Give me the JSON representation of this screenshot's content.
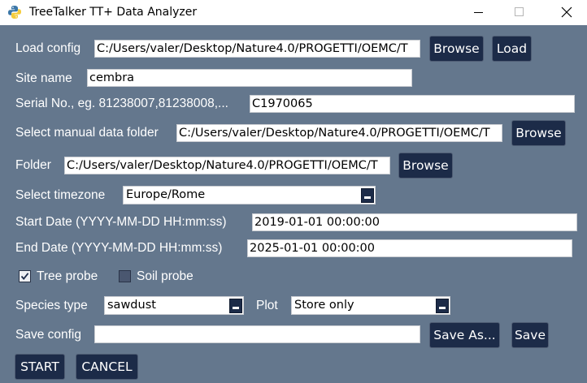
{
  "window": {
    "title": "TreeTalker TT+ Data Analyzer",
    "icon": "python-icon",
    "controls": [
      "minimize-icon",
      "maximize-icon",
      "close-icon"
    ]
  },
  "colors": {
    "background": "#64778d",
    "button": "#1c2b48",
    "text": "#ffffff",
    "field": "#ffffff"
  },
  "load_config": {
    "label": "Load config",
    "value": "C:/Users/valer/Desktop/Nature4.0/PROGETTI/OEMC/T",
    "browse_label": "Browse",
    "load_label": "Load"
  },
  "site_name": {
    "label": "Site name",
    "value": "cembra"
  },
  "serial_no": {
    "label": "Serial No., eg. 81238007,81238008,...",
    "value": "C1970065"
  },
  "manual_folder": {
    "label": "Select manual data folder",
    "value": "C:/Users/valer/Desktop/Nature4.0/PROGETTI/OEMC/T",
    "browse_label": "Browse"
  },
  "folder": {
    "label": "Folder",
    "value": "C:/Users/valer/Desktop/Nature4.0/PROGETTI/OEMC/T",
    "browse_label": "Browse"
  },
  "timezone": {
    "label": "Select timezone",
    "value": "Europe/Rome"
  },
  "start_date": {
    "label": "Start Date (YYYY-MM-DD HH:mm:ss)",
    "value": "2019-01-01 00:00:00"
  },
  "end_date": {
    "label": "End Date (YYYY-MM-DD HH:mm:ss)",
    "value": "2025-01-01 00:00:00"
  },
  "tree_probe": {
    "label": "Tree probe",
    "checked": true
  },
  "soil_probe": {
    "label": "Soil probe",
    "checked": false
  },
  "species": {
    "label": "Species type",
    "value": "sawdust"
  },
  "plot": {
    "label": "Plot",
    "value": "Store only"
  },
  "save_config": {
    "label": "Save config",
    "value": "",
    "save_as_label": "Save As...",
    "save_label": "Save"
  },
  "actions": {
    "start_label": "START",
    "cancel_label": "CANCEL"
  }
}
